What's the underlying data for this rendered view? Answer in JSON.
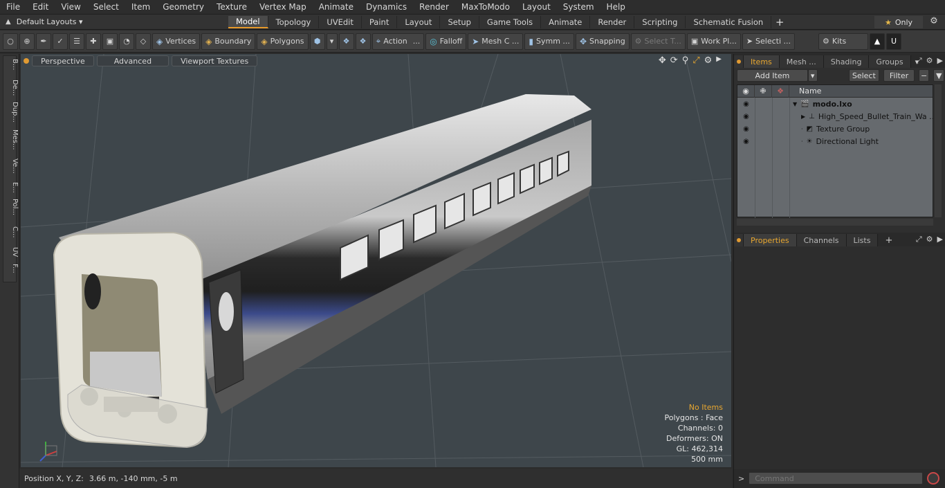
{
  "menu": [
    "File",
    "Edit",
    "View",
    "Select",
    "Item",
    "Geometry",
    "Texture",
    "Vertex Map",
    "Animate",
    "Dynamics",
    "Render",
    "MaxToModo",
    "Layout",
    "System",
    "Help"
  ],
  "layout_bar": {
    "default_layouts": "Default Layouts",
    "tabs": [
      "Model",
      "Topology",
      "UVEdit",
      "Paint",
      "Layout",
      "Setup",
      "Game Tools",
      "Animate",
      "Render",
      "Scripting",
      "Schematic Fusion"
    ],
    "active_tab": "Model",
    "plus": "+",
    "only_label": "Only"
  },
  "toolbar": {
    "vertices": "Vertices",
    "boundary": "Boundary",
    "polygons": "Polygons",
    "action": "Action",
    "falloff": "Falloff",
    "mesh": "Mesh C ...",
    "symmetry": "Symm ...",
    "snapping": "Snapping",
    "select_t": "Select T...",
    "work_plane": "Work Pl...",
    "selection": "Selecti ...",
    "kits": "Kits"
  },
  "left_tabs": [
    "B...",
    "De...",
    "Dup...",
    "Mes...",
    "Ve...",
    "E...",
    "Pol...",
    "C...",
    "UV",
    "F..."
  ],
  "viewport": {
    "perspective": "Perspective",
    "advanced": "Advanced",
    "viewport_textures": "Viewport Textures",
    "info": {
      "no_items": "No Items",
      "polygons": "Polygons : Face",
      "channels": "Channels: 0",
      "deformers": "Deformers: ON",
      "gl": "GL: 462,314",
      "scale": "500 mm"
    },
    "colors": {
      "background": "#3e464b",
      "warning": "#e8a730"
    }
  },
  "status": {
    "label": "Position X, Y, Z:",
    "value": "3.66 m, -140 mm, -5 m"
  },
  "items_panel": {
    "tabs": [
      "Items",
      "Mesh ...",
      "Shading",
      "Groups"
    ],
    "active_tab": "Items",
    "add_item": "Add Item",
    "select": "Select",
    "filter": "Filter",
    "name_header": "Name",
    "rows": [
      {
        "name": "modo.lxo",
        "icon": "scene-icon",
        "bold": true
      },
      {
        "name": "High_Speed_Bullet_Train_Wa ...",
        "icon": "mesh-locator-icon",
        "bold": false
      },
      {
        "name": "Texture Group",
        "icon": "texture-group-icon",
        "bold": false
      },
      {
        "name": "Directional Light",
        "icon": "light-icon",
        "bold": false
      }
    ]
  },
  "properties_panel": {
    "tabs": [
      "Properties",
      "Channels",
      "Lists"
    ],
    "active_tab": "Properties",
    "plus": "+"
  },
  "command": {
    "prompt": ">",
    "placeholder": "Command"
  }
}
